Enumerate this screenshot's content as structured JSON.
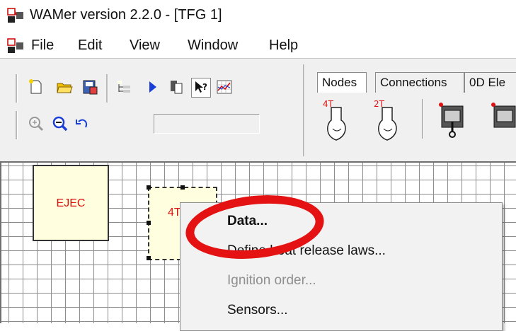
{
  "window": {
    "title": "WAMer version 2.2.0 - [TFG 1]"
  },
  "menu": {
    "items": [
      "File",
      "Edit",
      "View",
      "Window",
      "Help"
    ]
  },
  "toolbar": {
    "row1_icons": [
      "new-file-icon",
      "open-folder-icon",
      "save-icon",
      "tree-view-icon",
      "run-icon",
      "copy-icon",
      "help-pointer-icon",
      "chart-icon"
    ],
    "row2_icons": [
      "zoom-in-icon",
      "zoom-out-icon",
      "undo-icon"
    ],
    "status_field_value": ""
  },
  "tabs": {
    "items": [
      "Nodes",
      "Connections",
      "0D Ele"
    ],
    "active_index": 0
  },
  "palette": {
    "items": [
      {
        "label": "4T"
      },
      {
        "label": "2T"
      },
      {
        "label": ""
      },
      {
        "label": ""
      }
    ]
  },
  "canvas": {
    "ejec_label": "EJEC",
    "node_label": "4T"
  },
  "context_menu": {
    "items": [
      {
        "label": "Data...",
        "enabled": true
      },
      {
        "label": "Define heat release laws...",
        "enabled": true
      },
      {
        "label": "Ignition order...",
        "enabled": false
      },
      {
        "label": "Sensors...",
        "enabled": true
      }
    ]
  },
  "colors": {
    "highlight_ring": "#e41212",
    "node_fill": "#ffffe0",
    "node_text": "#dd1111"
  }
}
